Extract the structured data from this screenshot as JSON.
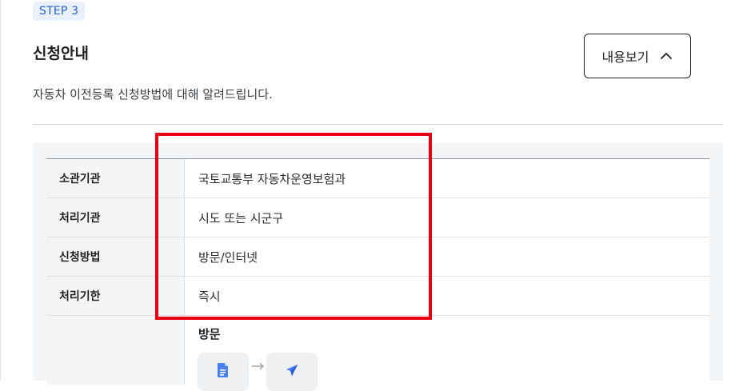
{
  "step": {
    "label": "STEP 3"
  },
  "header": {
    "title": "신청안내",
    "description": "자동차 이전등록 신청방법에 대해 알려드립니다."
  },
  "toggle": {
    "label": "내용보기",
    "icon": "chevron-up-icon"
  },
  "info_table": {
    "rows": [
      {
        "label": "소관기관",
        "value": "국토교통부 자동차운영보험과"
      },
      {
        "label": "처리기관",
        "value": "시도 또는 시군구"
      },
      {
        "label": "신청방법",
        "value": "방문/인터넷"
      },
      {
        "label": "처리기한",
        "value": "즉시"
      }
    ],
    "method_section": {
      "title": "방문",
      "step_icons": [
        "document-icon",
        "send-icon"
      ]
    }
  },
  "colors": {
    "accent_blue": "#2563d0",
    "badge_bg": "#eaf1fd",
    "highlight_red": "#e60012",
    "panel_bg": "#f4f5f6"
  }
}
